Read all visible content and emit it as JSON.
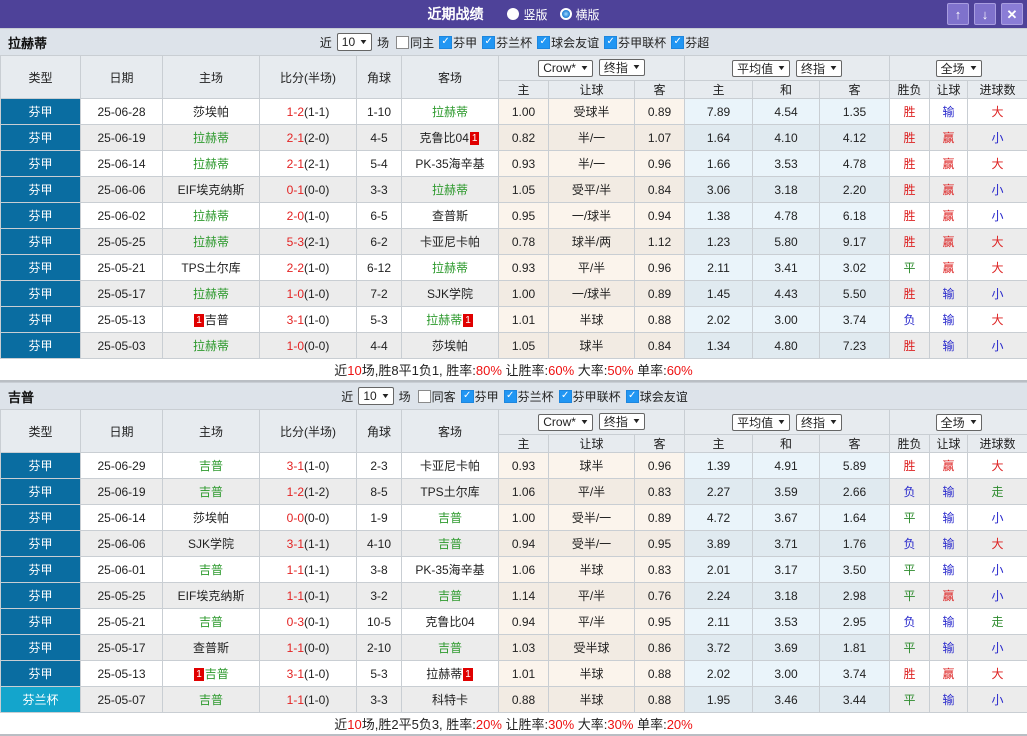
{
  "titlebar": {
    "title": "近期战绩",
    "radio_vertical": "竖版",
    "radio_horizontal": "横版",
    "selected": "横版",
    "up_icon": "↑",
    "down_icon": "↓",
    "close_icon": "✕"
  },
  "icons": {
    "check": "✓",
    "caret": "▼",
    "badge": "1"
  },
  "colors": {
    "accent_purple": "#4e4299",
    "league_primary_blue": "#0a6da1",
    "league_secondary_cyan": "#14a5cc",
    "self_team_green": "#2e9a2e",
    "win_red": "#dd2222",
    "lose_blue": "#2929cc",
    "draw_green": "#2e8b2e",
    "checkbox_blue": "#2196f3"
  },
  "table_header": {
    "type": "类型",
    "date": "日期",
    "home": "主场",
    "score": "比分(半场)",
    "corner": "角球",
    "away": "客场",
    "crow_dd": "Crow*",
    "final_dd": "终指",
    "avg_dd": "平均值",
    "final2_dd": "终指",
    "scope_dd": "全场",
    "sub": [
      "主",
      "让球",
      "客",
      "主",
      "和",
      "客",
      "胜负",
      "让球",
      "进球数"
    ]
  },
  "sections": [
    {
      "team": "拉赫蒂",
      "filter": {
        "prefix": "近",
        "count": "10",
        "suffix": "场",
        "same": {
          "label": "同主",
          "checked": false
        },
        "leagues": [
          {
            "label": "芬甲",
            "checked": true
          },
          {
            "label": "芬兰杯",
            "checked": true
          },
          {
            "label": "球会友谊",
            "checked": true
          },
          {
            "label": "芬甲联杯",
            "checked": true
          },
          {
            "label": "芬超",
            "checked": true
          }
        ]
      },
      "rows": [
        {
          "type": "芬甲",
          "type_variant": "a",
          "date": "25-06-28",
          "home": {
            "text": "莎埃帕",
            "self": false
          },
          "score": "1-2",
          "half": "(1-1)",
          "corner": "1-10",
          "away": {
            "text": "拉赫蒂",
            "self": true
          },
          "crow": [
            "1.00",
            "受球半",
            "0.89"
          ],
          "avg": [
            "7.89",
            "4.54",
            "1.35"
          ],
          "results": [
            {
              "t": "胜",
              "c": "red"
            },
            {
              "t": "输",
              "c": "blue"
            },
            {
              "t": "大",
              "c": "red"
            }
          ]
        },
        {
          "type": "芬甲",
          "type_variant": "a",
          "date": "25-06-19",
          "home": {
            "text": "拉赫蒂",
            "self": true
          },
          "score": "2-1",
          "half": "(2-0)",
          "corner": "4-5",
          "away": {
            "text": "克鲁比04",
            "self": false,
            "badge": "after"
          },
          "crow": [
            "0.82",
            "半/一",
            "1.07"
          ],
          "avg": [
            "1.64",
            "4.10",
            "4.12"
          ],
          "results": [
            {
              "t": "胜",
              "c": "red"
            },
            {
              "t": "赢",
              "c": "red"
            },
            {
              "t": "小",
              "c": "blue"
            }
          ]
        },
        {
          "type": "芬甲",
          "type_variant": "a",
          "date": "25-06-14",
          "home": {
            "text": "拉赫蒂",
            "self": true
          },
          "score": "2-1",
          "half": "(2-1)",
          "corner": "5-4",
          "away": {
            "text": "PK-35海辛基",
            "self": false
          },
          "crow": [
            "0.93",
            "半/一",
            "0.96"
          ],
          "avg": [
            "1.66",
            "3.53",
            "4.78"
          ],
          "results": [
            {
              "t": "胜",
              "c": "red"
            },
            {
              "t": "赢",
              "c": "red"
            },
            {
              "t": "大",
              "c": "red"
            }
          ]
        },
        {
          "type": "芬甲",
          "type_variant": "a",
          "date": "25-06-06",
          "home": {
            "text": "EIF埃克纳斯",
            "self": false
          },
          "score": "0-1",
          "half": "(0-0)",
          "corner": "3-3",
          "away": {
            "text": "拉赫蒂",
            "self": true
          },
          "crow": [
            "1.05",
            "受平/半",
            "0.84"
          ],
          "avg": [
            "3.06",
            "3.18",
            "2.20"
          ],
          "results": [
            {
              "t": "胜",
              "c": "red"
            },
            {
              "t": "赢",
              "c": "red"
            },
            {
              "t": "小",
              "c": "blue"
            }
          ]
        },
        {
          "type": "芬甲",
          "type_variant": "a",
          "date": "25-06-02",
          "home": {
            "text": "拉赫蒂",
            "self": true
          },
          "score": "2-0",
          "half": "(1-0)",
          "corner": "6-5",
          "away": {
            "text": "查普斯",
            "self": false
          },
          "crow": [
            "0.95",
            "一/球半",
            "0.94"
          ],
          "avg": [
            "1.38",
            "4.78",
            "6.18"
          ],
          "results": [
            {
              "t": "胜",
              "c": "red"
            },
            {
              "t": "赢",
              "c": "red"
            },
            {
              "t": "小",
              "c": "blue"
            }
          ]
        },
        {
          "type": "芬甲",
          "type_variant": "a",
          "date": "25-05-25",
          "home": {
            "text": "拉赫蒂",
            "self": true
          },
          "score": "5-3",
          "half": "(2-1)",
          "corner": "6-2",
          "away": {
            "text": "卡亚尼卡帕",
            "self": false
          },
          "crow": [
            "0.78",
            "球半/两",
            "1.12"
          ],
          "avg": [
            "1.23",
            "5.80",
            "9.17"
          ],
          "results": [
            {
              "t": "胜",
              "c": "red"
            },
            {
              "t": "赢",
              "c": "red"
            },
            {
              "t": "大",
              "c": "red"
            }
          ]
        },
        {
          "type": "芬甲",
          "type_variant": "a",
          "date": "25-05-21",
          "home": {
            "text": "TPS土尔库",
            "self": false
          },
          "score": "2-2",
          "half": "(1-0)",
          "corner": "6-12",
          "away": {
            "text": "拉赫蒂",
            "self": true
          },
          "crow": [
            "0.93",
            "平/半",
            "0.96"
          ],
          "avg": [
            "2.11",
            "3.41",
            "3.02"
          ],
          "results": [
            {
              "t": "平",
              "c": "green"
            },
            {
              "t": "赢",
              "c": "red"
            },
            {
              "t": "大",
              "c": "red"
            }
          ]
        },
        {
          "type": "芬甲",
          "type_variant": "a",
          "date": "25-05-17",
          "home": {
            "text": "拉赫蒂",
            "self": true
          },
          "score": "1-0",
          "half": "(1-0)",
          "corner": "7-2",
          "away": {
            "text": "SJK学院",
            "self": false
          },
          "crow": [
            "1.00",
            "一/球半",
            "0.89"
          ],
          "avg": [
            "1.45",
            "4.43",
            "5.50"
          ],
          "results": [
            {
              "t": "胜",
              "c": "red"
            },
            {
              "t": "输",
              "c": "blue"
            },
            {
              "t": "小",
              "c": "blue"
            }
          ]
        },
        {
          "type": "芬甲",
          "type_variant": "a",
          "date": "25-05-13",
          "home": {
            "text": "吉普",
            "self": false,
            "badge": "before"
          },
          "score": "3-1",
          "half": "(1-0)",
          "corner": "5-3",
          "away": {
            "text": "拉赫蒂",
            "self": true,
            "badge": "after"
          },
          "crow": [
            "1.01",
            "半球",
            "0.88"
          ],
          "avg": [
            "2.02",
            "3.00",
            "3.74"
          ],
          "results": [
            {
              "t": "负",
              "c": "blue"
            },
            {
              "t": "输",
              "c": "blue"
            },
            {
              "t": "大",
              "c": "red"
            }
          ]
        },
        {
          "type": "芬甲",
          "type_variant": "a",
          "date": "25-05-03",
          "home": {
            "text": "拉赫蒂",
            "self": true
          },
          "score": "1-0",
          "half": "(0-0)",
          "corner": "4-4",
          "away": {
            "text": "莎埃帕",
            "self": false
          },
          "crow": [
            "1.05",
            "球半",
            "0.84"
          ],
          "avg": [
            "1.34",
            "4.80",
            "7.23"
          ],
          "results": [
            {
              "t": "胜",
              "c": "red"
            },
            {
              "t": "输",
              "c": "blue"
            },
            {
              "t": "小",
              "c": "blue"
            }
          ]
        }
      ],
      "summary": [
        {
          "t": "近",
          "red": false
        },
        {
          "t": "10",
          "red": true
        },
        {
          "t": "场,胜8平1负1, 胜率:",
          "red": false
        },
        {
          "t": "80%",
          "red": true
        },
        {
          "t": " 让胜率:",
          "red": false
        },
        {
          "t": "60%",
          "red": true
        },
        {
          "t": " 大率:",
          "red": false
        },
        {
          "t": "50%",
          "red": true
        },
        {
          "t": " 单率:",
          "red": false
        },
        {
          "t": "60%",
          "red": true
        }
      ]
    },
    {
      "team": "吉普",
      "filter": {
        "prefix": "近",
        "count": "10",
        "suffix": "场",
        "same": {
          "label": "同客",
          "checked": false
        },
        "leagues": [
          {
            "label": "芬甲",
            "checked": true
          },
          {
            "label": "芬兰杯",
            "checked": true
          },
          {
            "label": "芬甲联杯",
            "checked": true
          },
          {
            "label": "球会友谊",
            "checked": true
          }
        ]
      },
      "rows": [
        {
          "type": "芬甲",
          "type_variant": "a",
          "date": "25-06-29",
          "home": {
            "text": "吉普",
            "self": true
          },
          "score": "3-1",
          "half": "(1-0)",
          "corner": "2-3",
          "away": {
            "text": "卡亚尼卡帕",
            "self": false
          },
          "crow": [
            "0.93",
            "球半",
            "0.96"
          ],
          "avg": [
            "1.39",
            "4.91",
            "5.89"
          ],
          "results": [
            {
              "t": "胜",
              "c": "red"
            },
            {
              "t": "赢",
              "c": "red"
            },
            {
              "t": "大",
              "c": "red"
            }
          ]
        },
        {
          "type": "芬甲",
          "type_variant": "a",
          "date": "25-06-19",
          "home": {
            "text": "吉普",
            "self": true
          },
          "score": "1-2",
          "half": "(1-2)",
          "corner": "8-5",
          "away": {
            "text": "TPS土尔库",
            "self": false
          },
          "crow": [
            "1.06",
            "平/半",
            "0.83"
          ],
          "avg": [
            "2.27",
            "3.59",
            "2.66"
          ],
          "results": [
            {
              "t": "负",
              "c": "blue"
            },
            {
              "t": "输",
              "c": "blue"
            },
            {
              "t": "走",
              "c": "green"
            }
          ]
        },
        {
          "type": "芬甲",
          "type_variant": "a",
          "date": "25-06-14",
          "home": {
            "text": "莎埃帕",
            "self": false
          },
          "score": "0-0",
          "half": "(0-0)",
          "corner": "1-9",
          "away": {
            "text": "吉普",
            "self": true
          },
          "crow": [
            "1.00",
            "受半/一",
            "0.89"
          ],
          "avg": [
            "4.72",
            "3.67",
            "1.64"
          ],
          "results": [
            {
              "t": "平",
              "c": "green"
            },
            {
              "t": "输",
              "c": "blue"
            },
            {
              "t": "小",
              "c": "blue"
            }
          ]
        },
        {
          "type": "芬甲",
          "type_variant": "a",
          "date": "25-06-06",
          "home": {
            "text": "SJK学院",
            "self": false
          },
          "score": "3-1",
          "half": "(1-1)",
          "corner": "4-10",
          "away": {
            "text": "吉普",
            "self": true
          },
          "crow": [
            "0.94",
            "受半/一",
            "0.95"
          ],
          "avg": [
            "3.89",
            "3.71",
            "1.76"
          ],
          "results": [
            {
              "t": "负",
              "c": "blue"
            },
            {
              "t": "输",
              "c": "blue"
            },
            {
              "t": "大",
              "c": "red"
            }
          ]
        },
        {
          "type": "芬甲",
          "type_variant": "a",
          "date": "25-06-01",
          "home": {
            "text": "吉普",
            "self": true
          },
          "score": "1-1",
          "half": "(1-1)",
          "corner": "3-8",
          "away": {
            "text": "PK-35海辛基",
            "self": false
          },
          "crow": [
            "1.06",
            "半球",
            "0.83"
          ],
          "avg": [
            "2.01",
            "3.17",
            "3.50"
          ],
          "results": [
            {
              "t": "平",
              "c": "green"
            },
            {
              "t": "输",
              "c": "blue"
            },
            {
              "t": "小",
              "c": "blue"
            }
          ]
        },
        {
          "type": "芬甲",
          "type_variant": "a",
          "date": "25-05-25",
          "home": {
            "text": "EIF埃克纳斯",
            "self": false
          },
          "score": "1-1",
          "half": "(0-1)",
          "corner": "3-2",
          "away": {
            "text": "吉普",
            "self": true
          },
          "crow": [
            "1.14",
            "平/半",
            "0.76"
          ],
          "avg": [
            "2.24",
            "3.18",
            "2.98"
          ],
          "results": [
            {
              "t": "平",
              "c": "green"
            },
            {
              "t": "赢",
              "c": "red"
            },
            {
              "t": "小",
              "c": "blue"
            }
          ]
        },
        {
          "type": "芬甲",
          "type_variant": "a",
          "date": "25-05-21",
          "home": {
            "text": "吉普",
            "self": true
          },
          "score": "0-3",
          "half": "(0-1)",
          "corner": "10-5",
          "away": {
            "text": "克鲁比04",
            "self": false
          },
          "crow": [
            "0.94",
            "平/半",
            "0.95"
          ],
          "avg": [
            "2.11",
            "3.53",
            "2.95"
          ],
          "results": [
            {
              "t": "负",
              "c": "blue"
            },
            {
              "t": "输",
              "c": "blue"
            },
            {
              "t": "走",
              "c": "green"
            }
          ]
        },
        {
          "type": "芬甲",
          "type_variant": "a",
          "date": "25-05-17",
          "home": {
            "text": "查普斯",
            "self": false
          },
          "score": "1-1",
          "half": "(0-0)",
          "corner": "2-10",
          "away": {
            "text": "吉普",
            "self": true
          },
          "crow": [
            "1.03",
            "受半球",
            "0.86"
          ],
          "avg": [
            "3.72",
            "3.69",
            "1.81"
          ],
          "results": [
            {
              "t": "平",
              "c": "green"
            },
            {
              "t": "输",
              "c": "blue"
            },
            {
              "t": "小",
              "c": "blue"
            }
          ]
        },
        {
          "type": "芬甲",
          "type_variant": "a",
          "date": "25-05-13",
          "home": {
            "text": "吉普",
            "self": true,
            "badge": "before"
          },
          "score": "3-1",
          "half": "(1-0)",
          "corner": "5-3",
          "away": {
            "text": "拉赫蒂",
            "self": false,
            "badge": "after"
          },
          "crow": [
            "1.01",
            "半球",
            "0.88"
          ],
          "avg": [
            "2.02",
            "3.00",
            "3.74"
          ],
          "results": [
            {
              "t": "胜",
              "c": "red"
            },
            {
              "t": "赢",
              "c": "red"
            },
            {
              "t": "大",
              "c": "red"
            }
          ]
        },
        {
          "type": "芬兰杯",
          "type_variant": "b",
          "date": "25-05-07",
          "home": {
            "text": "吉普",
            "self": true
          },
          "score": "1-1",
          "half": "(1-0)",
          "corner": "3-3",
          "away": {
            "text": "科特卡",
            "self": false
          },
          "crow": [
            "0.88",
            "半球",
            "0.88"
          ],
          "avg": [
            "1.95",
            "3.46",
            "3.44"
          ],
          "results": [
            {
              "t": "平",
              "c": "green"
            },
            {
              "t": "输",
              "c": "blue"
            },
            {
              "t": "小",
              "c": "blue"
            }
          ]
        }
      ],
      "summary": [
        {
          "t": "近",
          "red": false
        },
        {
          "t": "10",
          "red": true
        },
        {
          "t": "场,胜2平5负3, 胜率:",
          "red": false
        },
        {
          "t": "20%",
          "red": true
        },
        {
          "t": " 让胜率:",
          "red": false
        },
        {
          "t": "30%",
          "red": true
        },
        {
          "t": " 大率:",
          "red": false
        },
        {
          "t": "30%",
          "red": true
        },
        {
          "t": " 单率:",
          "red": false
        },
        {
          "t": "20%",
          "red": true
        }
      ]
    }
  ]
}
